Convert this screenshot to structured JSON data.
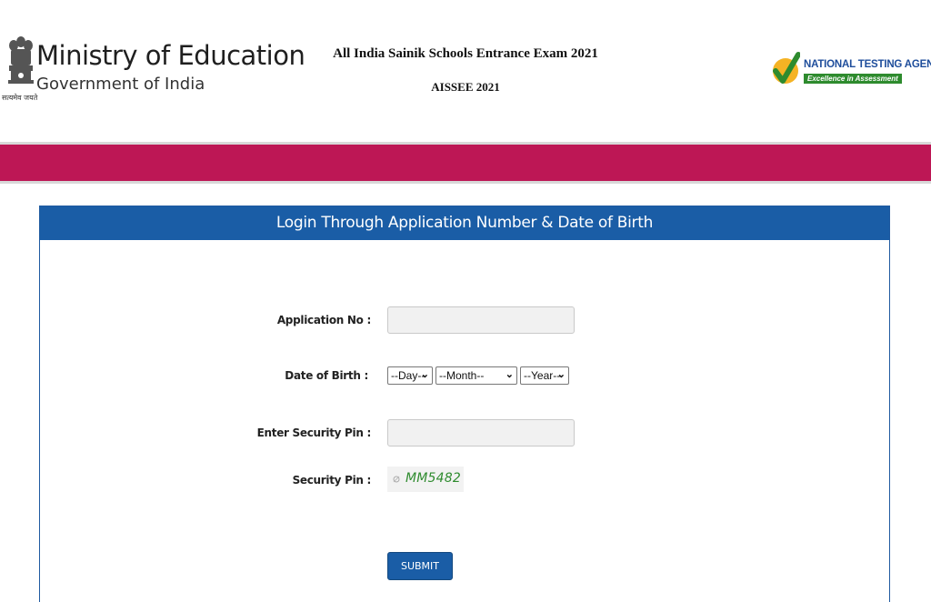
{
  "header": {
    "ministry_title": "Ministry of Education",
    "ministry_subtitle": "Government of India",
    "emblem_motto": "सत्यमेव जयते",
    "exam_title": "All India Sainik Schools Entrance Exam 2021",
    "exam_code": "AISSEE 2021",
    "agency_name": "NATIONAL TESTING AGENCY",
    "agency_tagline": "Excellence in Assessment"
  },
  "colors": {
    "banner": "#bd1755",
    "panel_header": "#1a5da6",
    "captcha_text": "#2e8b2e"
  },
  "panel": {
    "title": "Login Through Application Number & Date of Birth"
  },
  "form": {
    "application_no_label": "Application No :",
    "application_no_value": "",
    "dob_label": "Date of Birth :",
    "day_selected": "--Day--",
    "month_selected": "--Month--",
    "year_selected": "--Year--",
    "enter_pin_label": "Enter Security Pin :",
    "enter_pin_value": "",
    "security_pin_label": "Security Pin :",
    "security_pin_value": "MM5482",
    "submit_label": "SUBMIT"
  }
}
